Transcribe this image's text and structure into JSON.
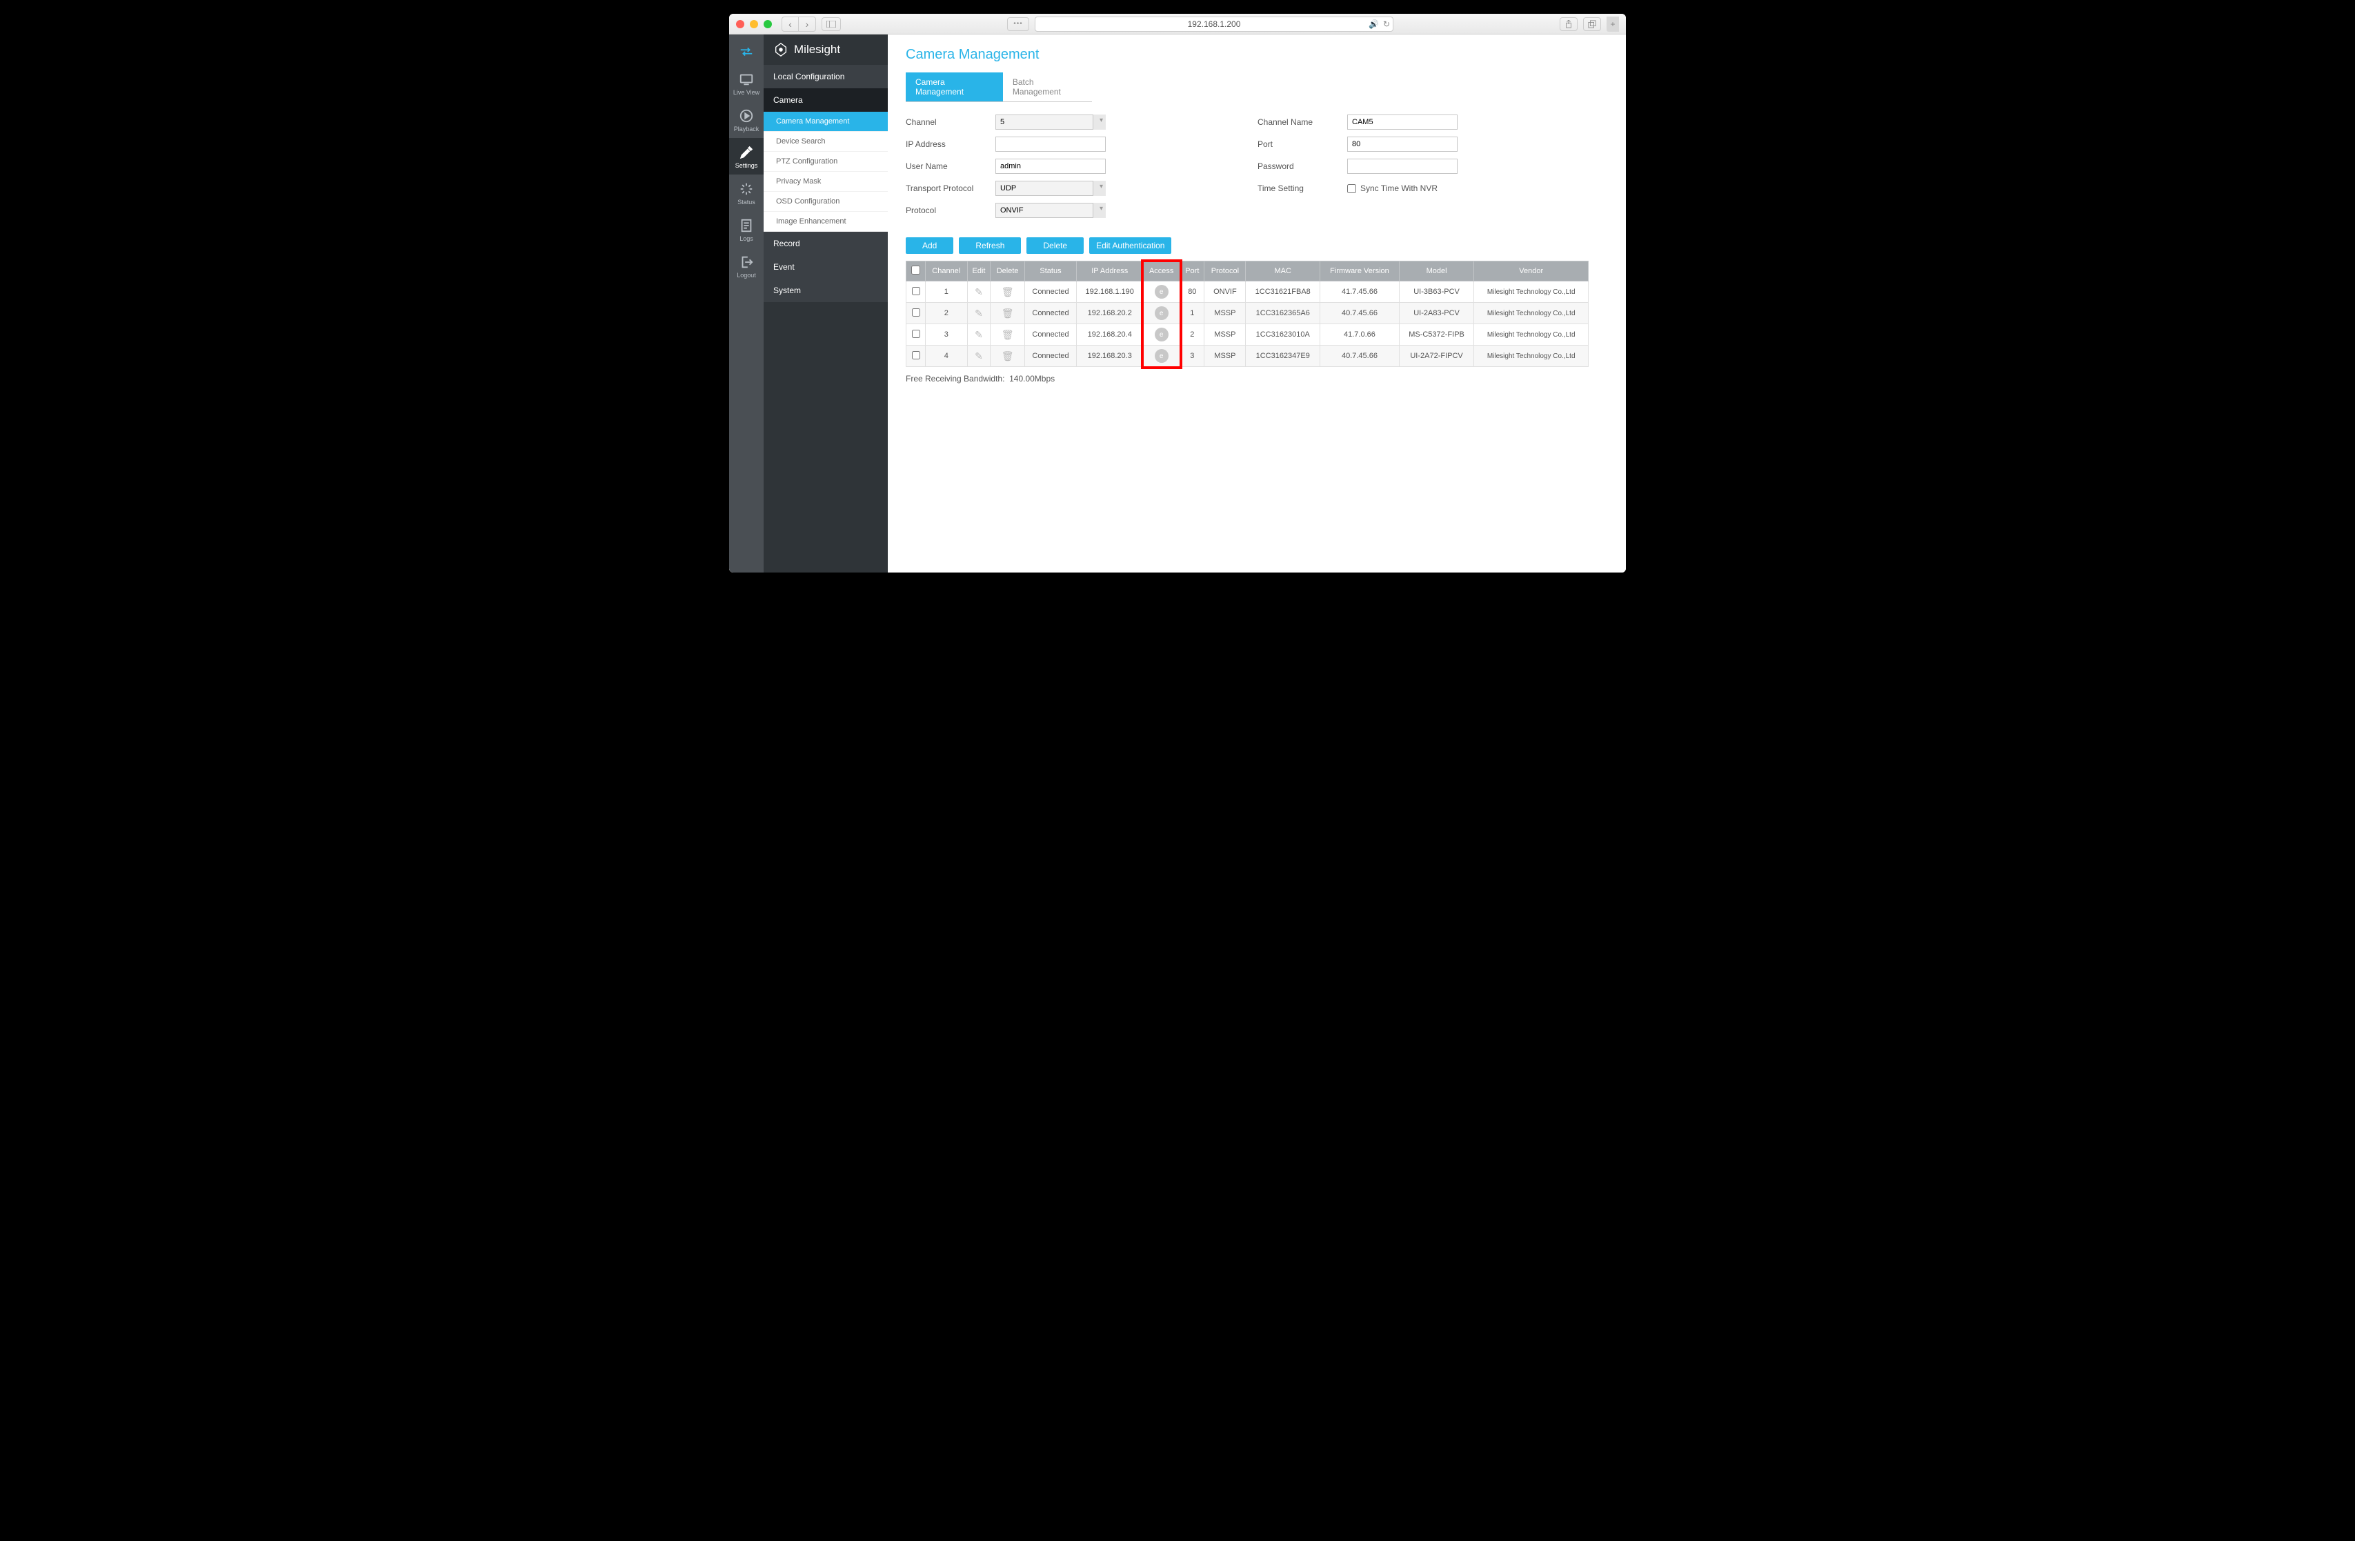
{
  "browser": {
    "url": "192.168.1.200"
  },
  "brand": "Milesight",
  "rail": [
    {
      "id": "liveview",
      "label": "Live View"
    },
    {
      "id": "playback",
      "label": "Playback"
    },
    {
      "id": "settings",
      "label": "Settings"
    },
    {
      "id": "status",
      "label": "Status"
    },
    {
      "id": "logs",
      "label": "Logs"
    },
    {
      "id": "logout",
      "label": "Logout"
    }
  ],
  "sidebar": {
    "local_config": "Local Configuration",
    "camera": "Camera",
    "camera_sub": [
      "Camera Management",
      "Device Search",
      "PTZ Configuration",
      "Privacy Mask",
      "OSD Configuration",
      "Image Enhancement"
    ],
    "record": "Record",
    "event": "Event",
    "system": "System"
  },
  "page": {
    "title": "Camera Management",
    "tabs": [
      "Camera Management",
      "Batch Management"
    ]
  },
  "form": {
    "channel_label": "Channel",
    "channel_value": "5",
    "ip_label": "IP Address",
    "ip_value": "",
    "user_label": "User Name",
    "user_value": "admin",
    "transport_label": "Transport Protocol",
    "transport_value": "UDP",
    "protocol_label": "Protocol",
    "protocol_value": "ONVIF",
    "channel_name_label": "Channel Name",
    "channel_name_value": "CAM5",
    "port_label": "Port",
    "port_value": "80",
    "password_label": "Password",
    "password_value": "",
    "time_label": "Time Setting",
    "time_sync": "Sync Time With NVR"
  },
  "buttons": {
    "add": "Add",
    "refresh": "Refresh",
    "delete": "Delete",
    "edit_auth": "Edit Authentication"
  },
  "table": {
    "headers": [
      "Channel",
      "Edit",
      "Delete",
      "Status",
      "IP Address",
      "Access",
      "Port",
      "Protocol",
      "MAC",
      "Firmware Version",
      "Model",
      "Vendor"
    ],
    "rows": [
      {
        "channel": "1",
        "status": "Connected",
        "ip": "192.168.1.190",
        "port": "80",
        "protocol": "ONVIF",
        "mac": "1CC31621FBA8",
        "fw": "41.7.45.66",
        "model": "UI-3B63-PCV",
        "vendor": "Milesight Technology Co.,Ltd"
      },
      {
        "channel": "2",
        "status": "Connected",
        "ip": "192.168.20.2",
        "port": "1",
        "protocol": "MSSP",
        "mac": "1CC3162365A6",
        "fw": "40.7.45.66",
        "model": "UI-2A83-PCV",
        "vendor": "Milesight Technology Co.,Ltd"
      },
      {
        "channel": "3",
        "status": "Connected",
        "ip": "192.168.20.4",
        "port": "2",
        "protocol": "MSSP",
        "mac": "1CC31623010A",
        "fw": "41.7.0.66",
        "model": "MS-C5372-FIPB",
        "vendor": "Milesight Technology Co.,Ltd"
      },
      {
        "channel": "4",
        "status": "Connected",
        "ip": "192.168.20.3",
        "port": "3",
        "protocol": "MSSP",
        "mac": "1CC3162347E9",
        "fw": "40.7.45.66",
        "model": "UI-2A72-FIPCV",
        "vendor": "Milesight Technology Co.,Ltd"
      }
    ]
  },
  "footer": {
    "bandwidth_label": "Free Receiving Bandwidth:",
    "bandwidth_value": "140.00Mbps"
  }
}
